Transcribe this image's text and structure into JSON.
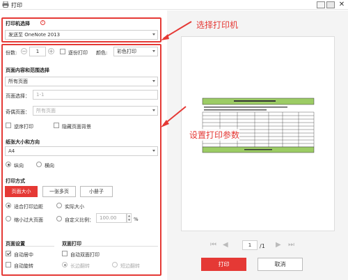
{
  "window": {
    "title": "打印"
  },
  "printer": {
    "section_title": "打印机选择",
    "selected": "发送至 OneNote 2013"
  },
  "copies": {
    "label": "份数:",
    "value": "1",
    "collate_label": "逐份打印",
    "color_label": "颜色:",
    "color_selected": "彩色打印"
  },
  "range": {
    "section_title": "页面内容和范围选择",
    "selected": "所有页面",
    "page_select_label": "页面选择：",
    "page_select_placeholder": "1-1",
    "odd_even_label": "奇偶页面：",
    "odd_even_selected": "所有页面",
    "reverse_label": "逆序打印",
    "hide_bg_label": "隐藏页面背景"
  },
  "paper": {
    "section_title": "纸张大小和方向",
    "selected": "A4",
    "portrait_label": "纵向",
    "landscape_label": "横向"
  },
  "mode": {
    "section_title": "打印方式",
    "buttons": [
      "页面大小",
      "一张多页",
      "小册子"
    ],
    "fit_margin_label": "适合打印边距",
    "actual_size_label": "实际大小",
    "shrink_label": "缩小过大页面",
    "custom_scale_label": "自定义比例：",
    "custom_scale_value": "100.00",
    "percent": "%"
  },
  "page_settings": {
    "section_title": "页面设置",
    "center_label": "自动居中",
    "rotate_label": "自动旋转"
  },
  "duplex": {
    "section_title": "双面打印",
    "auto_duplex_label": "自动双面打印",
    "long_edge_label": "长边翻转",
    "short_edge_label": "短边翻转"
  },
  "preview": {
    "page_value": "1",
    "page_total": "/1"
  },
  "actions": {
    "print_label": "打印",
    "cancel_label": "取消"
  },
  "annotations": {
    "select_printer": "选择打印机",
    "set_params": "设置打印参数"
  }
}
